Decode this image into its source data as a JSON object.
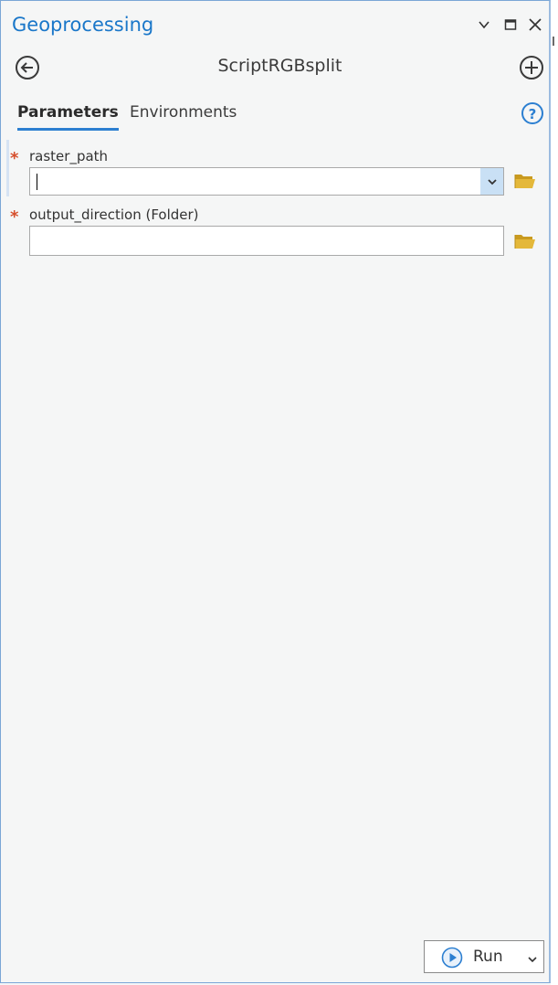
{
  "window": {
    "title": "Geoprocessing",
    "controls": [
      "chevron-down-icon",
      "maximize-icon",
      "close-icon"
    ]
  },
  "header": {
    "tool_name": "ScriptRGBsplit"
  },
  "tabs": [
    {
      "label": "Parameters",
      "active": true
    },
    {
      "label": "Environments",
      "active": false
    }
  ],
  "parameters": [
    {
      "label": "raster_path",
      "required": "*",
      "value": "",
      "control": "dropdown"
    },
    {
      "label": "output_direction  (Folder)",
      "required": "*",
      "value": "",
      "control": "text"
    }
  ],
  "footer": {
    "run_label": "Run"
  },
  "colors": {
    "accent": "#1a77c9",
    "required": "#d64f2d",
    "folder": "#e4b83a",
    "tab_underline": "#2c7fd1"
  }
}
